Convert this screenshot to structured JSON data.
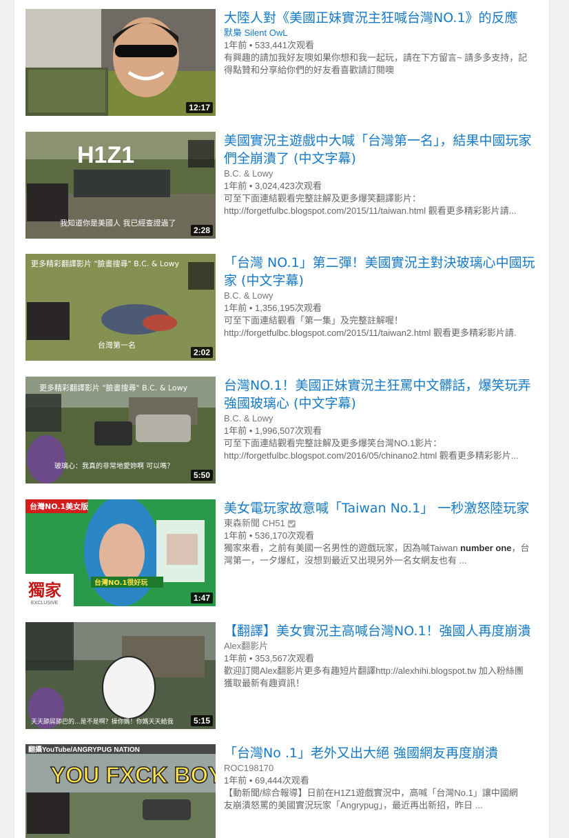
{
  "videos": [
    {
      "title": "大陸人對《美國正妹實況主狂喊台灣NO.1》的反應",
      "channel": "默梟 Silent OwL",
      "meta": "1年前 • 533,441次观看",
      "desc1": "有興趣的請加我好友噢如果你想和我一起玩，請在下方留言~ 請多多支持，記",
      "desc2": "得點贊和分享給你們的好友看喜歡請訂閱噢",
      "duration": "12:17",
      "thumb_text": ""
    },
    {
      "title": "美國實況主遊戲中大喊「台灣第一名」，結果中國玩家們全崩潰了 (中文字幕)",
      "channel": "B.C. & Lowy",
      "meta": "1年前 • 3,024,423次观看",
      "desc1": "可至下面連結觀看完整註解及更多爆笑翻譯影片：",
      "desc2": "http://forgetfulbc.blogspot.com/2015/11/taiwan.html 觀看更多精彩影片請...",
      "duration": "2:28",
      "thumb_text": "H1Z1",
      "thumb_caption": "我知道你是美國人 我已經查證過了"
    },
    {
      "title": "「台灣 NO.1」第二彈！美國實況主對決玻璃心中國玩家 (中文字幕)",
      "channel": "B.C. & Lowy",
      "meta": "1年前 • 1,356,195次观看",
      "desc1": "可至下面連結觀看「第一集」及完整註解喔！",
      "desc2": "http://forgetfulbc.blogspot.com/2015/11/taiwan2.html 觀看更多精彩影片請.",
      "duration": "2:02",
      "thumb_text": "更多精彩翻譯影片 \"臉書搜尋\" B.C. & Lowy",
      "thumb_caption": "台灣第一名"
    },
    {
      "title": "台灣NO.1！美國正妹實況主狂罵中文髒話，爆笑玩弄強國玻璃心 (中文字幕)",
      "channel": "B.C. & Lowy",
      "meta": "1年前 • 1,996,507次观看",
      "desc1": "可至下面連結觀看完整註解及更多爆笑台灣NO.1影片：",
      "desc2": "http://forgetfulbc.blogspot.com/2016/05/chinano2.html 觀看更多精彩影片...",
      "duration": "5:50",
      "thumb_text": "更多精彩翻譯影片 \"臉書搜尋\" B.C. & Lowy",
      "thumb_caption": "玻璃心：我真的非常地愛妳啊 可以嗎？"
    },
    {
      "title": "美女電玩家故意喊「Taiwan No.1」 一秒激怒陸玩家",
      "channel": "東森新聞 CH51",
      "meta": "1年前 • 536,170次观看",
      "desc1_pre": "獨家來看，之前有美國一名男性的遊戲玩家，因為喊Taiwan ",
      "desc1_bold": "number one",
      "desc1_post": "，台",
      "desc2": "灣第一，一夕爆紅，沒想到最近又出現另外一名女網友也有 ...",
      "duration": "1:47",
      "thumb_text": "台灣NO.1美女版",
      "thumb_caption": "台灣NO.1很好玩",
      "thumb_brand": "獨家",
      "thumb_sub": "EXCLUSIVE"
    },
    {
      "title": "【翻譯】美女實況主高喊台灣NO.1！強國人再度崩潰",
      "channel": "Alex翻影片",
      "meta": "1年前 • 353,567次观看",
      "desc1": "歡迎訂閱Alex翻影片更多有趣短片翻譯http://alexhihi.blogspot.tw 加入粉絲團",
      "desc2": "獲取最新有趣資訊！",
      "duration": "5:15",
      "thumb_caption": "天天舔屌舔巴的...是不是啊？操你媽！你媽天天給我"
    },
    {
      "title": "「台灣No .1」老外又出大絕 強國網友再度崩潰",
      "channel": "ROC198170",
      "meta": "1年前 • 69,444次观看",
      "desc1": "【動新聞/綜合報導】日前在H1Z1遊戲實況中，高喊「台灣No.1」讓中國網",
      "desc2": "友崩潰怒罵的美國實況玩家「Angrypug」，最近再出新招，昨日 ...",
      "duration": "",
      "thumb_text": "YOU FXCK BOY",
      "thumb_top": "翻攝YouTube/ANGRYPUG NATION"
    }
  ]
}
